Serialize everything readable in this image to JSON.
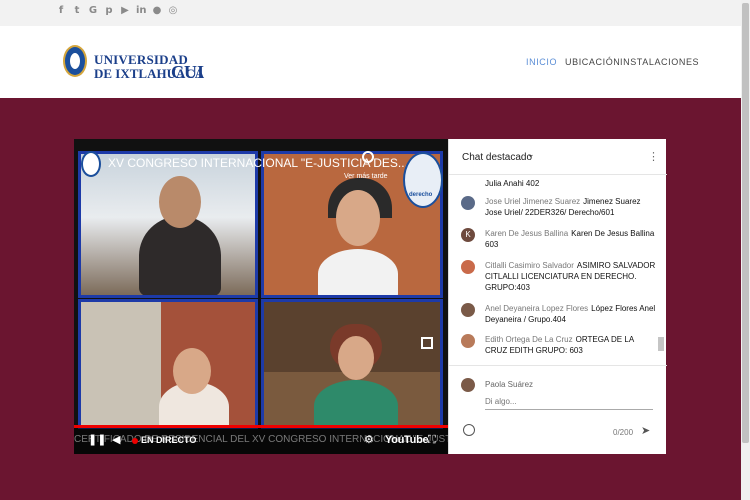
{
  "social_icons": [
    "facebook-icon",
    "twitter-icon",
    "google-plus-icon",
    "pinterest-icon",
    "youtube-icon",
    "linkedin-icon",
    "flickr-icon",
    "whatsapp-icon"
  ],
  "logo": {
    "line1": "UNIVERSIDAD",
    "line2": "DE IXTLAHUACA",
    "brand": "CUI"
  },
  "nav": {
    "items": [
      {
        "label": "INICIO",
        "active": true
      },
      {
        "label": "UBICACIÓN",
        "active": false
      },
      {
        "label": "INSTALACIONES",
        "active": false
      }
    ]
  },
  "video": {
    "title": "XV CONGRESO INTERNACIONAL \"E-JUSTICIA DES...",
    "watch_later": "Ver más tarde",
    "seal_text": "derecho",
    "live_label": "EN DIRECTO",
    "marquee": "CERTIFICADO DE RESIDENCIAL DEL XV CONGRESO INTERNACIONAL \"E-JUSTICIA. DESAFÍOS Y CONTEXTO",
    "platform": "YouTube",
    "progress": 1.0
  },
  "chat": {
    "title": "Chat destacado",
    "messages": [
      {
        "initial": "",
        "author": "",
        "text": "Julia Anahi 402"
      },
      {
        "initial": "",
        "author": "Jose Uriel Jimenez Suarez",
        "text": "Jimenez Suarez Jose Uriel/ 22DER326/ Derecho/601"
      },
      {
        "initial": "K",
        "author": "Karen De Jesus Ballina",
        "text": "Karen De Jesus Ballina 603"
      },
      {
        "initial": "",
        "author": "Citlalli Casimiro Salvador",
        "text": "ASIMIRO SALVADOR CITLALLI LICENCIATURA EN DERECHO. GRUPO:403"
      },
      {
        "initial": "",
        "author": "Anel Deyaneira Lopez Flores",
        "text": "López Flores Anel Deyaneira / Grupo.404"
      },
      {
        "initial": "",
        "author": "Edith Ortega De La Cruz",
        "text": "ORTEGA DE LA CRUZ EDITH GRUPO: 603"
      }
    ],
    "user_name": "Paola Suárez",
    "input_placeholder": "Di algo...",
    "counter": "0/200"
  },
  "colors": {
    "background": "#6b1530",
    "nav_active": "#5b8ed6",
    "brand_blue": "#1b3f8a",
    "live_red": "#e00000"
  }
}
